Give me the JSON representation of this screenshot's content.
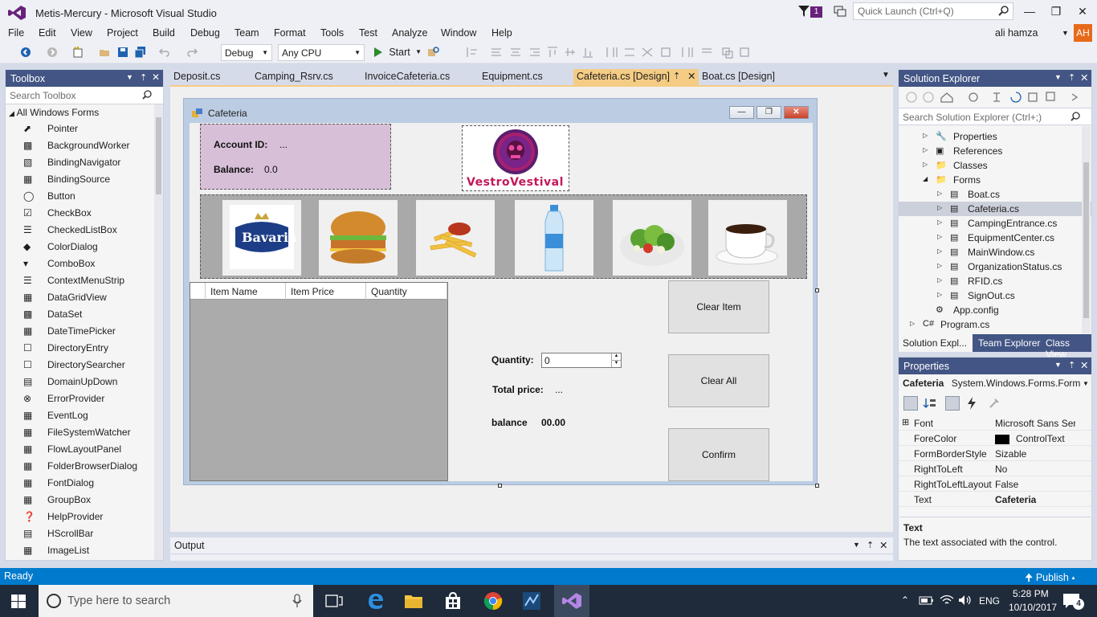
{
  "window": {
    "title": "Metis-Mercury - Microsoft Visual Studio",
    "quick_launch_placeholder": "Quick Launch (Ctrl+Q)",
    "notification_count": "1"
  },
  "menu": [
    "File",
    "Edit",
    "View",
    "Project",
    "Build",
    "Debug",
    "Team",
    "Format",
    "Tools",
    "Test",
    "Analyze",
    "Window",
    "Help"
  ],
  "user": {
    "name": "ali hamza",
    "initials": "AH"
  },
  "toolbar": {
    "configuration": "Debug",
    "platform": "Any CPU",
    "start_label": "Start"
  },
  "toolbox": {
    "title": "Toolbox",
    "search_placeholder": "Search Toolbox",
    "category": "All Windows Forms",
    "items": [
      "Pointer",
      "BackgroundWorker",
      "BindingNavigator",
      "BindingSource",
      "Button",
      "CheckBox",
      "CheckedListBox",
      "ColorDialog",
      "ComboBox",
      "ContextMenuStrip",
      "DataGridView",
      "DataSet",
      "DateTimePicker",
      "DirectoryEntry",
      "DirectorySearcher",
      "DomainUpDown",
      "ErrorProvider",
      "EventLog",
      "FileSystemWatcher",
      "FlowLayoutPanel",
      "FolderBrowserDialog",
      "FontDialog",
      "GroupBox",
      "HelpProvider",
      "HScrollBar",
      "ImageList"
    ]
  },
  "tabs": [
    "Deposit.cs",
    "Camping_Rsrv.cs",
    "InvoiceCafeteria.cs",
    "Equipment.cs",
    "Cafeteria.cs [Design]",
    "Boat.cs [Design]"
  ],
  "form": {
    "title": "Cafeteria",
    "account_id_label": "Account ID:",
    "account_id_value": "...",
    "balance_label": "Balance:",
    "balance_value": "0.0",
    "logo_text": "VestroVestival",
    "products": [
      "Bavaria",
      "Burger",
      "Fries",
      "Water",
      "Salad",
      "Coffee"
    ],
    "bavaria_text": "Bavaria",
    "grid_columns": [
      "Item Name",
      "Item Price",
      "Quantity"
    ],
    "quantity_label": "Quantity:",
    "quantity_value": "0",
    "total_price_label": "Total price:",
    "total_price_value": "...",
    "balance2_label": "balance",
    "balance2_value": "00.00",
    "buttons": {
      "clear_item": "Clear Item",
      "clear_all": "Clear All",
      "confirm": "Confirm"
    }
  },
  "output": {
    "title": "Output"
  },
  "solution_explorer": {
    "title": "Solution Explorer",
    "search_placeholder": "Search Solution Explorer (Ctrl+;)",
    "rows": [
      "Properties",
      "References",
      "Classes",
      "Forms",
      "Boat.cs",
      "Cafeteria.cs",
      "CampingEntrance.cs",
      "EquipmentCenter.cs",
      "MainWindow.cs",
      "OrganizationStatus.cs",
      "RFID.cs",
      "SignOut.cs",
      "App.config",
      "Program.cs"
    ],
    "tabs": [
      "Solution Expl...",
      "Team Explorer",
      "Class View"
    ]
  },
  "properties": {
    "title": "Properties",
    "object": "Cafeteria",
    "type": "System.Windows.Forms.Form",
    "rows": [
      {
        "name": "Font",
        "value": "Microsoft Sans Serif"
      },
      {
        "name": "ForeColor",
        "value": "ControlText"
      },
      {
        "name": "FormBorderStyle",
        "value": "Sizable"
      },
      {
        "name": "RightToLeft",
        "value": "No"
      },
      {
        "name": "RightToLeftLayout",
        "value": "False"
      },
      {
        "name": "Text",
        "value": "Cafeteria"
      }
    ],
    "desc_title": "Text",
    "desc_text": "The text associated with the control."
  },
  "status": {
    "text": "Ready",
    "publish": "Publish"
  },
  "taskbar": {
    "search_placeholder": "Type here to search",
    "language": "ENG",
    "time": "5:28 PM",
    "date": "10/10/2017",
    "notifications": "4"
  },
  "colors": {
    "accent": "#007acc",
    "vs_purple": "#68217a",
    "tab_active": "#f5cc84",
    "panel_header": "#425584"
  }
}
